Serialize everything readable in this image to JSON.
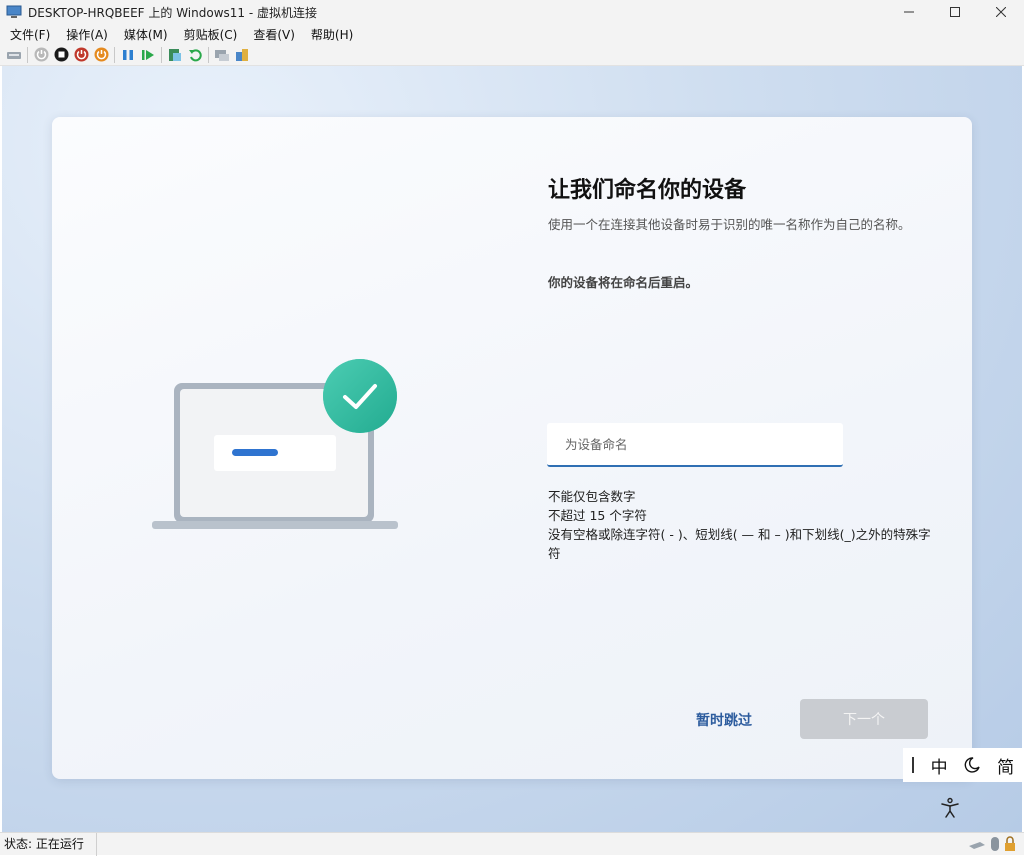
{
  "window": {
    "title": "DESKTOP-HRQBEEF 上的 Windows11 - 虚拟机连接",
    "buttons": [
      "minimize-icon",
      "maximize-icon",
      "close-icon"
    ]
  },
  "menu": [
    "文件(F)",
    "操作(A)",
    "媒体(M)",
    "剪贴板(C)",
    "查看(V)",
    "帮助(H)"
  ],
  "toolbar_icons": [
    "ctrl-alt-del-icon",
    "start-icon",
    "turn-off-icon",
    "shutdown-icon",
    "power-icon",
    "pause-icon",
    "resume-icon",
    "checkpoint-icon",
    "revert-icon",
    "enhanced-session-icon",
    "share-icon"
  ],
  "setup": {
    "heading": "让我们命名你的设备",
    "description": "使用一个在连接其他设备时易于识别的唯一名称作为自己的名称。",
    "restart_note": "你的设备将在命名后重启。",
    "input_value": "",
    "input_placeholder": "为设备命名",
    "rules": [
      "不能仅包含数字",
      "不超过 15 个字符",
      "没有空格或除连字符( - )、短划线( — 和 – )和下划线(_)之外的特殊字符"
    ],
    "skip_label": "暂时跳过",
    "next_label": "下一个"
  },
  "ime": {
    "mode": "中",
    "width": "简"
  },
  "status": {
    "text": "状态: 正在运行"
  },
  "colors": {
    "accent": "#2f6fb3",
    "link": "#2d5c9e",
    "check": "#2fbfa0",
    "next_disabled": "#c9ccd1"
  }
}
